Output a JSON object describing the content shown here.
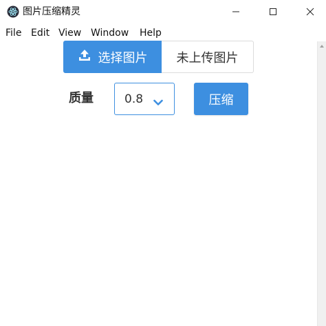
{
  "window": {
    "title": "图片压缩精灵",
    "controls": {
      "minimize": "minimize",
      "maximize": "maximize",
      "close": "close"
    }
  },
  "menu": {
    "items": [
      "File",
      "Edit",
      "View",
      "Window",
      "Help"
    ]
  },
  "upload": {
    "button_label": "选择图片",
    "status_text": "未上传图片"
  },
  "quality": {
    "label": "质量",
    "selected": "0.8"
  },
  "actions": {
    "compress_label": "压缩"
  },
  "colors": {
    "accent": "#3d8fe0",
    "border": "#dbdbdb",
    "text": "#333333"
  },
  "icons": {
    "app": "electron-atom-icon",
    "upload": "upload-icon",
    "select": "chevron-down-icon"
  }
}
